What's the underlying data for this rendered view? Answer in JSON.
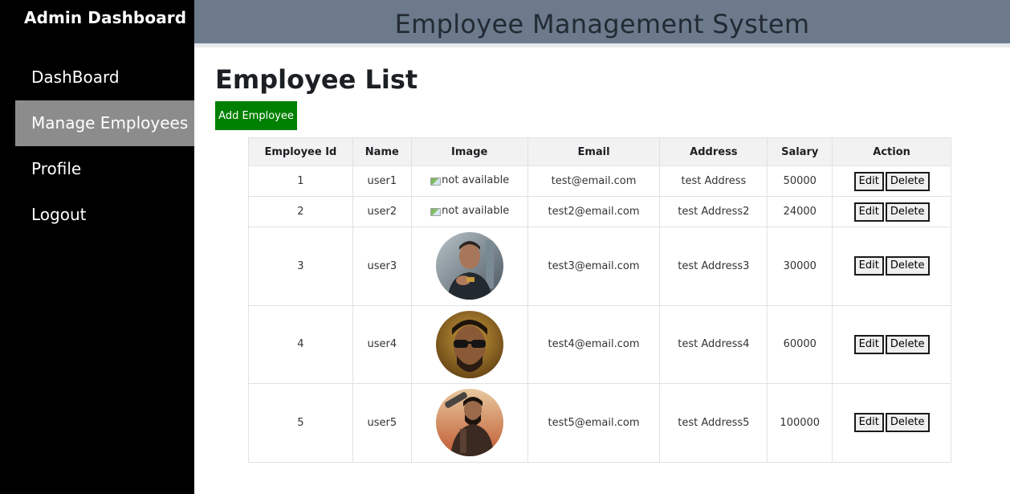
{
  "sidebar": {
    "brand": "Admin Dashboard",
    "items": [
      {
        "label": "DashBoard",
        "active": false
      },
      {
        "label": "Manage Employees",
        "active": true
      },
      {
        "label": "Profile",
        "active": false
      },
      {
        "label": "Logout",
        "active": false
      }
    ]
  },
  "header": {
    "title": "Employee Management System"
  },
  "main": {
    "title": "Employee List",
    "add_button": "Add Employee",
    "columns": [
      "Employee Id",
      "Name",
      "Image",
      "Email",
      "Address",
      "Salary",
      "Action"
    ],
    "rows": [
      {
        "id": "1",
        "name": "user1",
        "image_alt": "not available",
        "email": "test@email.com",
        "address": "test Address",
        "salary": "50000"
      },
      {
        "id": "2",
        "name": "user2",
        "image_alt": "not available",
        "email": "test2@email.com",
        "address": "test Address2",
        "salary": "24000"
      },
      {
        "id": "3",
        "name": "user3",
        "email": "test3@email.com",
        "address": "test Address3",
        "salary": "30000"
      },
      {
        "id": "4",
        "name": "user4",
        "email": "test4@email.com",
        "address": "test Address4",
        "salary": "60000"
      },
      {
        "id": "5",
        "name": "user5",
        "email": "test5@email.com",
        "address": "test Address5",
        "salary": "100000"
      }
    ],
    "edit_label": "Edit",
    "delete_label": "Delete"
  },
  "colors": {
    "sidebar_bg": "#000000",
    "active_item_bg": "#8c8c8c",
    "header_bg": "#6c7a8c",
    "add_button_bg": "#008000",
    "table_header_bg": "#f2f2f2"
  },
  "icons": [
    "broken-image-icon"
  ]
}
